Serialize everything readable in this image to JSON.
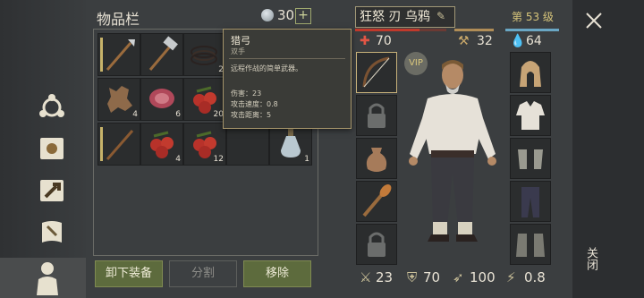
{
  "inventory": {
    "title": "物品栏",
    "currency_count": "30",
    "add_label": "+",
    "slots": [
      {
        "item": "spear",
        "count": ""
      },
      {
        "item": "hammer",
        "count": ""
      },
      {
        "item": "rope",
        "count": "2"
      },
      {
        "item": "bow",
        "count": ""
      },
      {
        "item": "leather",
        "count": "4"
      },
      {
        "item": "raw-meat",
        "count": "6"
      },
      {
        "item": "berries",
        "count": "20"
      },
      {
        "item": "empty",
        "count": ""
      },
      {
        "item": "stick",
        "count": ""
      },
      {
        "item": "berries",
        "count": "4"
      },
      {
        "item": "berries",
        "count": "12"
      },
      {
        "item": "empty",
        "count": ""
      },
      {
        "item": "potion",
        "count": "1"
      }
    ]
  },
  "tooltip": {
    "name": "猎弓",
    "type": "双手",
    "description": "远程作战的简单武器。",
    "stats": [
      "伤害：23",
      "攻击速度：0.8",
      "攻击距离：5"
    ]
  },
  "buttons": {
    "unequip": "卸下装备",
    "split": "分割",
    "remove": "移除"
  },
  "character": {
    "name": "狂怒 刃 乌鸦",
    "level": "第 53 级",
    "health": "70",
    "hunger": "32",
    "thirst": "64",
    "vip": "VIP",
    "stats": {
      "damage": "23",
      "armor": "70",
      "speed": "100",
      "attack_speed": "0.8"
    }
  },
  "close_label": "关闭",
  "colors": {
    "health": "#c0392b",
    "hunger": "#b08d57",
    "thirst": "#6aa7c4",
    "accent": "#5d6b3d"
  }
}
